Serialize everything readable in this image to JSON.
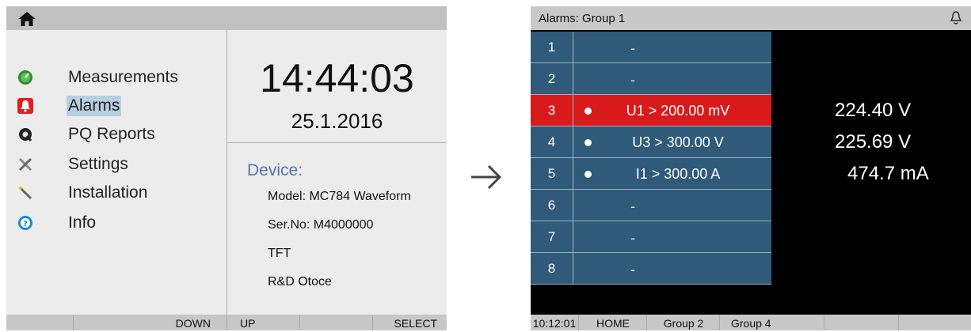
{
  "left_screen": {
    "menu": [
      {
        "label": "Measurements",
        "icon": "measurements-icon",
        "selected": false
      },
      {
        "label": "Alarms",
        "icon": "alarm-bell-icon",
        "selected": true
      },
      {
        "label": "PQ Reports",
        "icon": "pq-reports-icon",
        "selected": false
      },
      {
        "label": "Settings",
        "icon": "tools-icon",
        "selected": false
      },
      {
        "label": "Installation",
        "icon": "wand-icon",
        "selected": false
      },
      {
        "label": "Info",
        "icon": "info-icon",
        "selected": false
      }
    ],
    "time": "14:44:03",
    "date": "25.1.2016",
    "device": {
      "title": "Device:",
      "lines": [
        "Model: MC784 Waveform",
        "Ser.No: M4000000",
        "TFT",
        "R&D Otoce"
      ]
    },
    "function_keys": [
      "",
      "DOWN",
      "UP",
      "",
      "SELECT"
    ]
  },
  "right_screen": {
    "title": "Alarms: Group 1",
    "rows": [
      {
        "num": "1",
        "condition": "-",
        "value": "",
        "active": false,
        "alert": false
      },
      {
        "num": "2",
        "condition": "-",
        "value": "",
        "active": false,
        "alert": false
      },
      {
        "num": "3",
        "condition": "U1 > 200.00 mV",
        "value": "224.40 V",
        "active": true,
        "alert": true
      },
      {
        "num": "4",
        "condition": "U3 > 300.00 V",
        "value": "225.69 V",
        "active": true,
        "alert": false
      },
      {
        "num": "5",
        "condition": "I1 > 300.00 A",
        "value": "474.7 mA",
        "active": true,
        "alert": false
      },
      {
        "num": "6",
        "condition": "-",
        "value": "",
        "active": false,
        "alert": false
      },
      {
        "num": "7",
        "condition": "-",
        "value": "",
        "active": false,
        "alert": false
      },
      {
        "num": "8",
        "condition": "-",
        "value": "",
        "active": false,
        "alert": false
      }
    ],
    "bottom_bar": [
      "10:12:01",
      "HOME",
      "Group 2",
      "Group 4",
      "",
      ""
    ]
  },
  "colors": {
    "alert_row": "#d81a1a",
    "row_bg": "#2f5a7a",
    "selection": "#b8cfe0"
  }
}
